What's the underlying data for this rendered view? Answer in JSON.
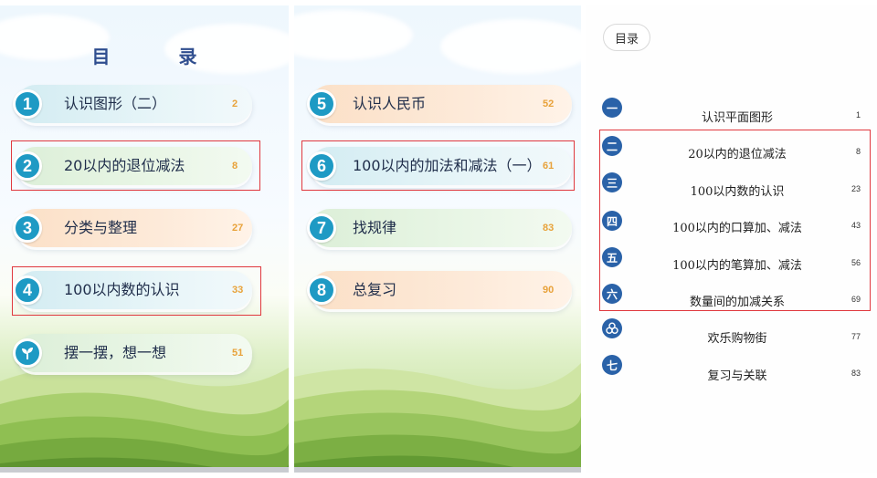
{
  "left_panel": {
    "title": "目 录",
    "entries": [
      {
        "num": "1",
        "label": "认识图形（二）",
        "page": "2"
      },
      {
        "num": "2",
        "label": "20以内的退位减法",
        "page": "8"
      },
      {
        "num": "3",
        "label": "分类与整理",
        "page": "27"
      },
      {
        "num": "4",
        "label": "100以内数的认识",
        "page": "33"
      },
      {
        "num": "",
        "icon": "sprout-icon",
        "label": "摆一摆，想一想",
        "page": "51"
      }
    ]
  },
  "middle_panel": {
    "entries": [
      {
        "num": "5",
        "label": "认识人民币",
        "page": "52"
      },
      {
        "num": "6",
        "label": "100以内的加法和减法（一）",
        "page": "61"
      },
      {
        "num": "7",
        "label": "找规律",
        "page": "83"
      },
      {
        "num": "8",
        "label": "总复习",
        "page": "90"
      }
    ]
  },
  "right_panel": {
    "toc_button": "目录",
    "entries": [
      {
        "icon": "一",
        "label": "认识平面图形",
        "page": "1"
      },
      {
        "icon": "二",
        "label": "20以内的退位减法",
        "page": "8"
      },
      {
        "icon": "三",
        "label": "100以内数的认识",
        "page": "23"
      },
      {
        "icon": "四",
        "label": "100以内的口算加、减法",
        "page": "43"
      },
      {
        "icon": "五",
        "label": "100以内的笔算加、减法",
        "page": "56"
      },
      {
        "icon": "六",
        "label": "数量间的加减关系",
        "page": "69"
      },
      {
        "icon": "",
        "icon_name": "trefoil-icon",
        "label": "欢乐购物街",
        "page": "77"
      },
      {
        "icon": "七",
        "label": "复习与关联",
        "page": "83"
      }
    ]
  },
  "colors": {
    "highlight": "#e0383e",
    "blue": "#1e9ac4",
    "orange": "#f09a36",
    "green": "#59a44b",
    "navy_icon": "#2a62a8"
  }
}
